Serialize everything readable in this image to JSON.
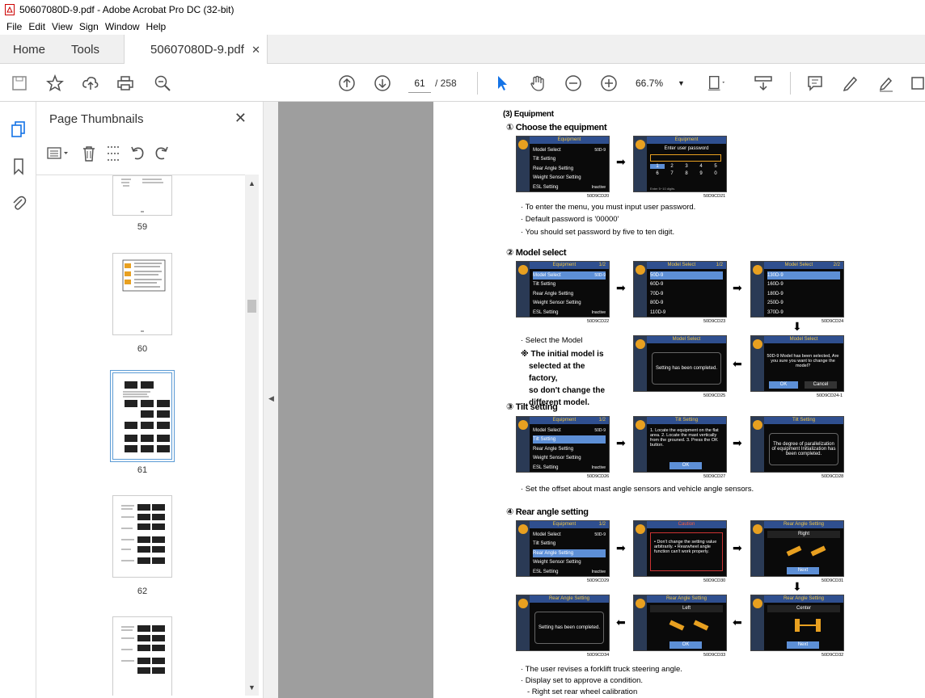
{
  "window": {
    "title": "50607080D-9.pdf - Adobe Acrobat Pro DC (32-bit)"
  },
  "menu": [
    "File",
    "Edit",
    "View",
    "Sign",
    "Window",
    "Help"
  ],
  "tabs": {
    "home": "Home",
    "tools": "Tools",
    "doc": "50607080D-9.pdf"
  },
  "toolbar": {
    "page_current": "61",
    "page_total": "/ 258",
    "zoom": "66.7%"
  },
  "panel": {
    "title": "Page Thumbnails",
    "thumb_labels": [
      "59",
      "60",
      "61",
      "62"
    ]
  },
  "doc": {
    "h3": "(3) Equipment",
    "s1": "① Choose the equipment",
    "b1": [
      "· To enter the menu, you must input user password.",
      "· Default password is '00000'",
      "· You should set password by five to ten digit."
    ],
    "s2": "② Model select",
    "b2": "· Select the Model",
    "note": [
      "※ The initial model is",
      "selected at the factory,",
      "so don't change the",
      "different model."
    ],
    "s3": "③ Tilt setting",
    "b3": "· Set the offset about mast angle sensors and vehicle angle sensors.",
    "s4": "④ Rear angle setting",
    "b4": [
      "· The user revises a forklift truck steering angle.",
      "· Display set to approve a condition.",
      "- Right set rear wheel calibration"
    ],
    "screens": {
      "equip_menu": {
        "header": "Equipment",
        "rows": [
          "Model Select",
          "Tilt Setting",
          "Rear Angle Setting",
          "Weight Sensor Setting",
          "ESL Setting"
        ],
        "val": "50D-9",
        "inactive": "Inactive"
      },
      "equip_menu2": {
        "header": "Equipment",
        "page": "1/2"
      },
      "password": {
        "header": "Equipment",
        "prompt": "Enter user password",
        "keys": [
          "1",
          "2",
          "3",
          "4",
          "5",
          "6",
          "7",
          "8",
          "9",
          "0"
        ],
        "hint": "Enter 5~10 digits."
      },
      "model_list1": {
        "header": "Model Select",
        "page": "1/2",
        "rows": [
          "50D-9",
          "60D-9",
          "70D-9",
          "80D-9",
          "110D-9"
        ]
      },
      "model_list2": {
        "header": "Model Select",
        "page": "2/2",
        "rows": [
          "130D-9",
          "160D-9",
          "180D-9",
          "250D-9",
          "370D-9"
        ]
      },
      "model_confirm": {
        "header": "Model Select",
        "msg": "50D-9 Model has been selected, Are you sure you want to change the model?",
        "ok": "OK",
        "cancel": "Cancel"
      },
      "model_done": {
        "header": "Model Select",
        "msg": "Setting has been completed."
      },
      "tilt1": {
        "header": "Tilt Setting",
        "msg": "1. Locate the equipment on the flat area. 2. Locate the mast vertically from the grouned. 3. Press the OK button.",
        "ok": "OK"
      },
      "tilt2": {
        "header": "Tilt Setting",
        "msg": "The degree of parallelization of equipment Initialization has been completed."
      },
      "caution": {
        "header": "Caution",
        "msg": "• Don't change the setting value arbitrarily. • Rearwheel angle function can't work properly."
      },
      "rear_right": {
        "header": "Rear Angle Setting",
        "label": "Right",
        "btn": "Next"
      },
      "rear_done": {
        "header": "Rear Angle Setting",
        "msg": "Setting has been completed."
      },
      "rear_left": {
        "header": "Rear Angle Setting",
        "label": "Left",
        "btn": "OK"
      },
      "rear_center": {
        "header": "Rear Angle Setting",
        "label": "Center",
        "btn": "Next"
      }
    },
    "captions": [
      "50D9CD20",
      "50D9CD21",
      "50D9CD22",
      "50D9CD23",
      "50D9CD24",
      "50D9CD25",
      "50D9CD24-1",
      "50D9CD26",
      "50D9CD27",
      "50D9CD28",
      "50D9CD29",
      "50D9CD30",
      "50D9CD31",
      "50D9CD34",
      "50D9CD33",
      "50D9CD32"
    ]
  }
}
